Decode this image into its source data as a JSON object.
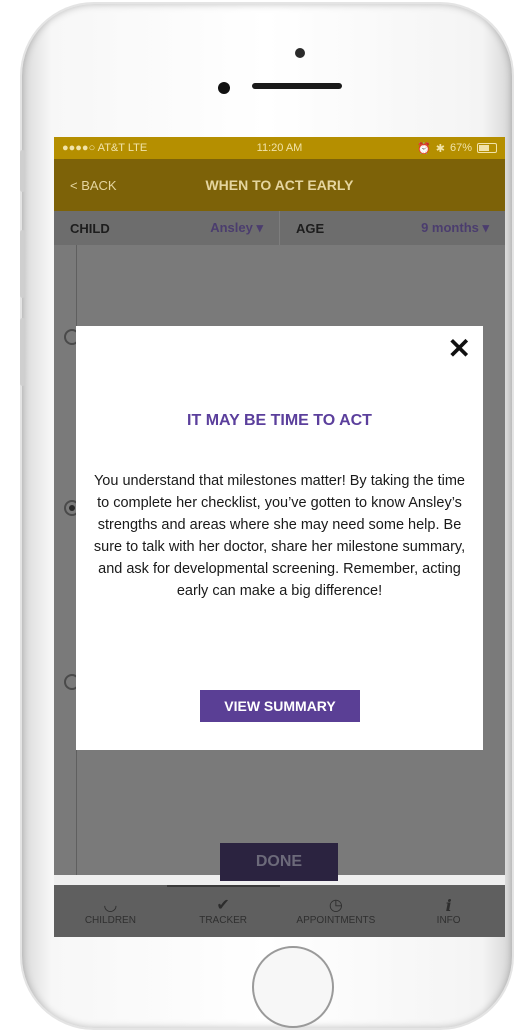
{
  "status_bar": {
    "carrier": "●●●●○ AT&T  LTE",
    "time": "11:20 AM",
    "battery": "67%"
  },
  "nav": {
    "back_label": "< BACK",
    "title": "WHEN TO ACT EARLY"
  },
  "selector": {
    "child_label": "CHILD",
    "child_value": "Ansley ▾",
    "age_label": "AGE",
    "age_value": "9 months ▾"
  },
  "modal": {
    "close_symbol": "✕",
    "title": "IT MAY BE TIME TO ACT",
    "body": "You understand that milestones matter! By taking the time to complete her checklist, you’ve gotten to know Ansley’s strengths and areas where she may need some help. Be sure to talk with her doctor, share her milestone summary, and ask for developmental screening. Remember, acting early can make a big difference!",
    "button_label": "VIEW SUMMARY"
  },
  "done_label": "DONE",
  "tabs": [
    {
      "label": "CHILDREN",
      "icon": "child-face-icon",
      "glyph": "◡"
    },
    {
      "label": "TRACKER",
      "icon": "checkmark-icon",
      "glyph": "✔"
    },
    {
      "label": "APPOINTMENTS",
      "icon": "clock-icon",
      "glyph": "◷"
    },
    {
      "label": "INFO",
      "icon": "info-icon",
      "glyph": "i"
    }
  ],
  "colors": {
    "status_bar": "#b58f00",
    "nav_bar": "#7d6208",
    "accent_purple": "#5a3f95",
    "title_purple": "#5b3f9c"
  }
}
